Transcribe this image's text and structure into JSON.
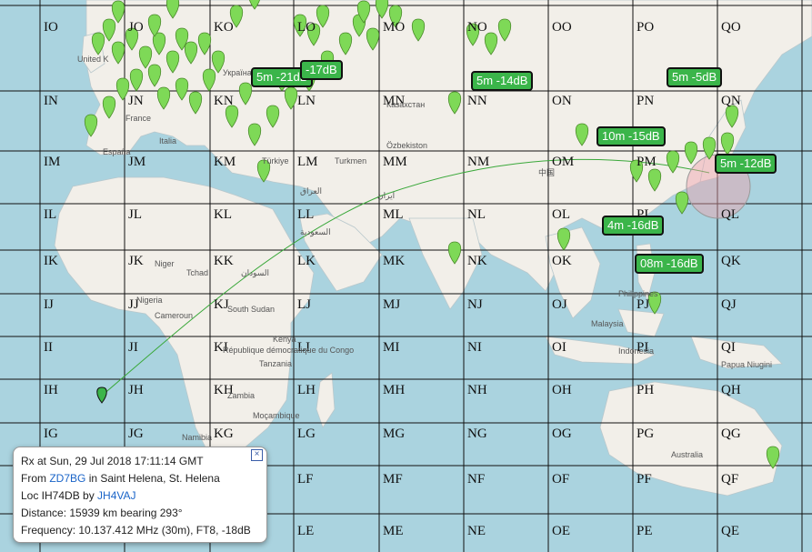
{
  "grid_labels": [
    [
      "IO",
      "JO",
      "KO",
      "LO",
      "MO",
      "NO",
      "OO",
      "PO",
      "QO"
    ],
    [
      "IN",
      "JN",
      "KN",
      "LN",
      "MN",
      "NN",
      "ON",
      "PN",
      "QN"
    ],
    [
      "IM",
      "JM",
      "KM",
      "LM",
      "MM",
      "NM",
      "OM",
      "PM",
      "QM"
    ],
    [
      "IL",
      "JL",
      "KL",
      "LL",
      "ML",
      "NL",
      "OL",
      "PL",
      "QL"
    ],
    [
      "IK",
      "JK",
      "KK",
      "LK",
      "MK",
      "NK",
      "OK",
      "PK",
      "QK"
    ],
    [
      "IJ",
      "JJ",
      "KJ",
      "LJ",
      "MJ",
      "NJ",
      "OJ",
      "PJ",
      "QJ"
    ],
    [
      "II",
      "JI",
      "KI",
      "LI",
      "MI",
      "NI",
      "OI",
      "PI",
      "QI"
    ],
    [
      "IH",
      "JH",
      "KH",
      "LH",
      "MH",
      "NH",
      "OH",
      "PH",
      "QH"
    ],
    [
      "IG",
      "JG",
      "KG",
      "LG",
      "MG",
      "NG",
      "OG",
      "PG",
      "QG"
    ],
    [
      "",
      "",
      "",
      "LF",
      "MF",
      "NF",
      "OF",
      "PF",
      "QF"
    ],
    [
      "",
      "",
      "",
      "LE",
      "ME",
      "NE",
      "OE",
      "PE",
      "QE"
    ]
  ],
  "spot_labels": [
    "5m -21dB",
    "-17dB",
    "5m -14dB",
    "5m -5dB",
    "10m -15dB",
    "5m -12dB",
    "4m -16dB",
    "08m -16dB"
  ],
  "geo_labels": [
    "United K",
    "France",
    "España",
    "Italia",
    "Türkiye",
    "Казахстан",
    "Özbekiston",
    "Turkmen",
    "العراق",
    "ایران",
    "السعودية",
    "Niger",
    "Tchad",
    "السودان",
    "Nigeria",
    "Cameroun",
    "South Sudan",
    "Kenya",
    "République démocratique du Congo",
    "Tanzania",
    "Zambia",
    "Moçambique",
    "Namibia",
    "中国",
    "Philippines",
    "Malaysia",
    "Indonesia",
    "Papua Niugini",
    "Australia",
    "Україна"
  ],
  "popup": {
    "rx_line": "Rx at Sun, 29 Jul 2018 17:11:14 GMT",
    "from_prefix": "From ",
    "from_call": "ZD7BG",
    "from_suffix": " in Saint Helena, St. Helena",
    "loc_prefix": "Loc IH74DB by ",
    "loc_call": "JH4VAJ",
    "distance": "Distance: 15939 km bearing 293°",
    "frequency": "Frequency: 10.137.412 MHz (30m), FT8, -18dB",
    "close_symbol": "×"
  },
  "colors": {
    "water": "#aad3df",
    "land": "#f2efe9",
    "marker": "#7ed957",
    "label_bg": "#3bb54a"
  }
}
